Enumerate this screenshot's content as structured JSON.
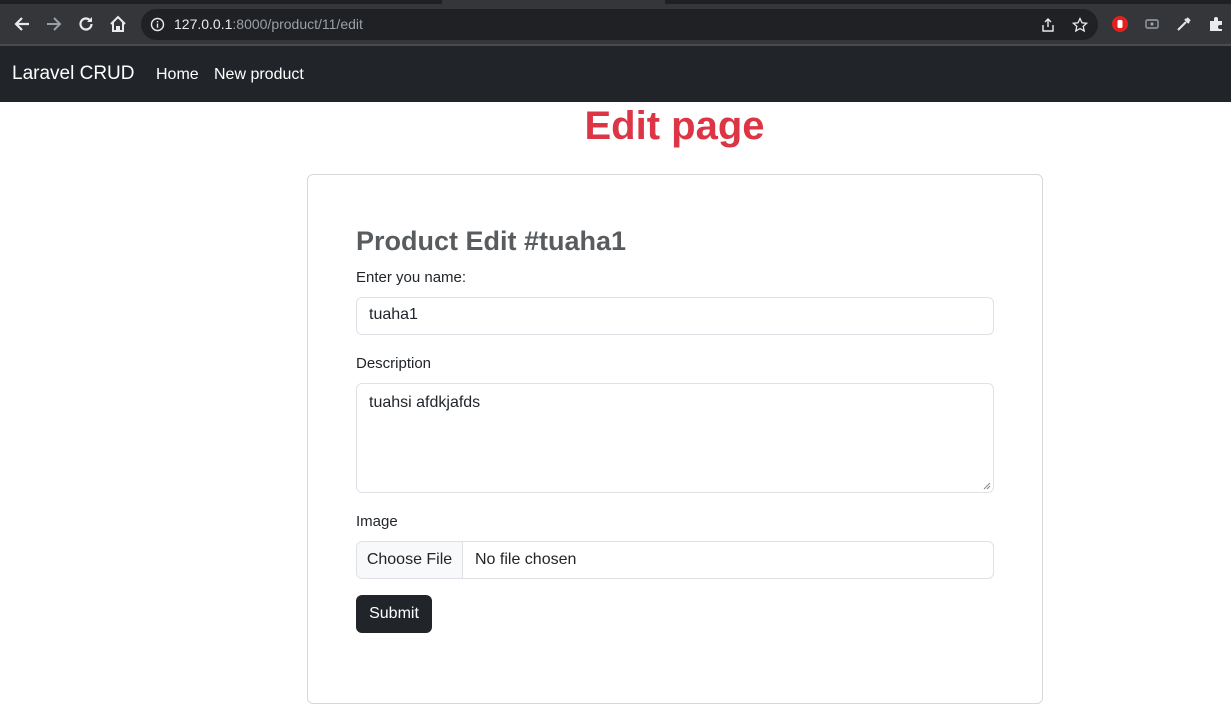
{
  "browser": {
    "url_host": "127.0.0.1",
    "url_rest": ":8000/product/11/edit",
    "icons": [
      "back-icon",
      "forward-icon",
      "reload-icon",
      "home-icon",
      "info-icon",
      "share-icon",
      "star-icon",
      "extension-icons"
    ]
  },
  "navbar": {
    "brand": "Laravel CRUD",
    "links": [
      "Home",
      "New product"
    ]
  },
  "page": {
    "title": "Edit page",
    "title_color": "#dc3545"
  },
  "form": {
    "heading": "Product Edit #tuaha1",
    "name_label": "Enter you name:",
    "name_value": "tuaha1",
    "description_label": "Description",
    "description_value": "tuahsi afdkjafds",
    "image_label": "Image",
    "file_button": "Choose File",
    "file_status": "No file chosen",
    "submit_label": "Submit"
  }
}
